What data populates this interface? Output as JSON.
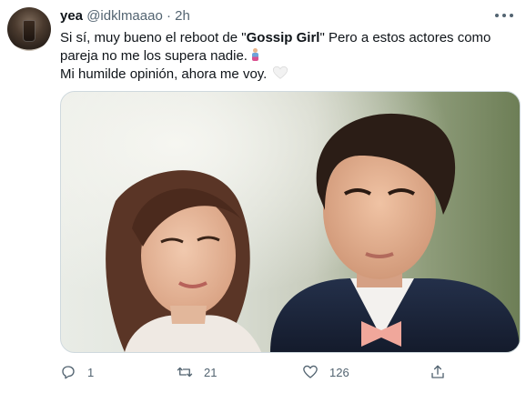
{
  "tweet": {
    "author_name": "yea",
    "handle": "@idklmaaao",
    "separator": "·",
    "time": "2h",
    "text_line1_pre": "Si sí, muy bueno el reboot de \"",
    "text_line1_bold": "Gossip Girl",
    "text_line1_post": "\" Pero a estos actores como",
    "text_line2": "pareja no me los supera nadie.",
    "text_line3": "Mi humilde opinión, ahora me voy.",
    "emoji_1": "person-icon",
    "emoji_2": "white-heart-icon"
  },
  "actions": {
    "reply_count": "1",
    "retweet_count": "21",
    "like_count": "126"
  },
  "colors": {
    "text_primary": "#0f1419",
    "text_secondary": "#536471",
    "border": "#cfd9de"
  }
}
